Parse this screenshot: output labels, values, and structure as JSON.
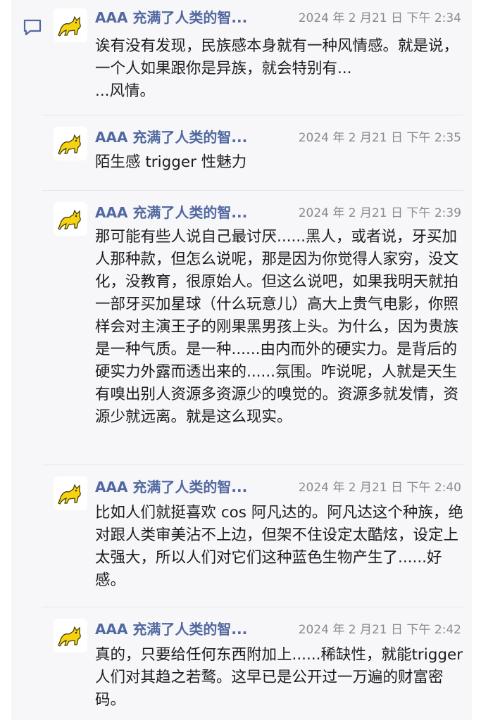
{
  "comments": [
    {
      "author": "AAA 充满了人类的智...",
      "time": "2024 年 2 月21 日 下午 2:34",
      "text": "诶有没有发现，民族感本身就有一种风情感。就是说，一个人如果跟你是异族，就会特别有...\n...风情。"
    },
    {
      "author": "AAA 充满了人类的智...",
      "time": "2024 年 2 月21 日 下午 2:35",
      "text": "陌生感 trigger 性魅力"
    },
    {
      "author": "AAA 充满了人类的智...",
      "time": "2024 年 2 月21 日 下午 2:39",
      "text": "那可能有些人说自己最讨厌......黑人，或者说，牙买加人那种款，但怎么说呢，那是因为你觉得人家穷，没文化，没教育，很原始人。但这么说吧，如果我明天就拍一部牙买加星球（什么玩意儿）高大上贵气电影，你照样会对主演王子的刚果黑男孩上头。为什么，因为贵族是一种气质。是一种......由内而外的硬实力。是背后的硬实力外露而透出来的......氛围。咋说呢，人就是天生有嗅出别人资源多资源少的嗅觉的。资源多就发情，资源少就远离。就是这么现实。"
    },
    {
      "author": "AAA 充满了人类的智...",
      "time": "2024 年 2 月21 日 下午 2:40",
      "text": "比如人们就挺喜欢 cos 阿凡达的。阿凡达这个种族，绝对跟人类审美沾不上边，但架不住设定太酷炫，设定上太强大，所以人们对它们这种蓝色生物产生了......好感。"
    },
    {
      "author": "AAA 充满了人类的智...",
      "time": "2024 年 2 月21 日 下午 2:42",
      "text": "真的，只要给任何东西附加上......稀缺性，就能trigger 人们对其趋之若鹜。这早已是公开过一万遍的财富密码。"
    }
  ],
  "colors": {
    "author": "#5168a0",
    "time": "#8a8a8f",
    "text": "#1c1c1e",
    "card_background": "#f7f7f9",
    "icon": "#5168a0",
    "avatar_figure": "#f5d311"
  },
  "icons": {
    "side": "comment-bubble-icon",
    "avatar": "yellow-cat-avatar"
  }
}
